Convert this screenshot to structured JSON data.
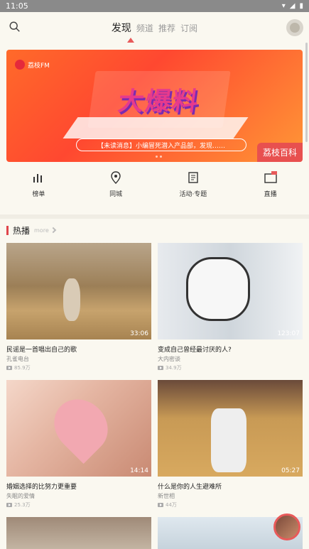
{
  "status_bar": {
    "time": "11:05"
  },
  "header": {
    "tabs": [
      {
        "label": "发现",
        "active": true
      },
      {
        "label": "频道",
        "active": false
      },
      {
        "label": "推荐",
        "active": false
      },
      {
        "label": "订阅",
        "active": false
      }
    ]
  },
  "banner": {
    "logo": "荔枝FM",
    "headline": "大爆料",
    "caption": "【未读消息】小编冒死潜入产品部，发现……",
    "corner_tag": "荔枝百科"
  },
  "quick_nav": [
    {
      "label": "榜单",
      "icon": "chart-icon"
    },
    {
      "label": "同城",
      "icon": "location-icon"
    },
    {
      "label": "活动·专题",
      "icon": "document-icon"
    },
    {
      "label": "直播",
      "icon": "live-icon"
    }
  ],
  "section": {
    "title": "热播",
    "more": "more"
  },
  "cards": [
    {
      "title": "民谣是一首唱出自己的歌",
      "author": "孔雀电台",
      "plays": "85.9万",
      "duration": "33:06"
    },
    {
      "title": "变成自己曾经最讨厌的人?",
      "author": "大内密谈",
      "plays": "34.9万",
      "duration": "123:07"
    },
    {
      "title": "婚姻选择的比努力更重要",
      "author": "失眠的爱情",
      "plays": "25.3万",
      "duration": "14:14"
    },
    {
      "title": "什么是你的人生避难所",
      "author": "新世相",
      "plays": "44万",
      "duration": "05:27"
    }
  ],
  "colors": {
    "accent": "#e85a5a",
    "background": "#faf8f0"
  }
}
